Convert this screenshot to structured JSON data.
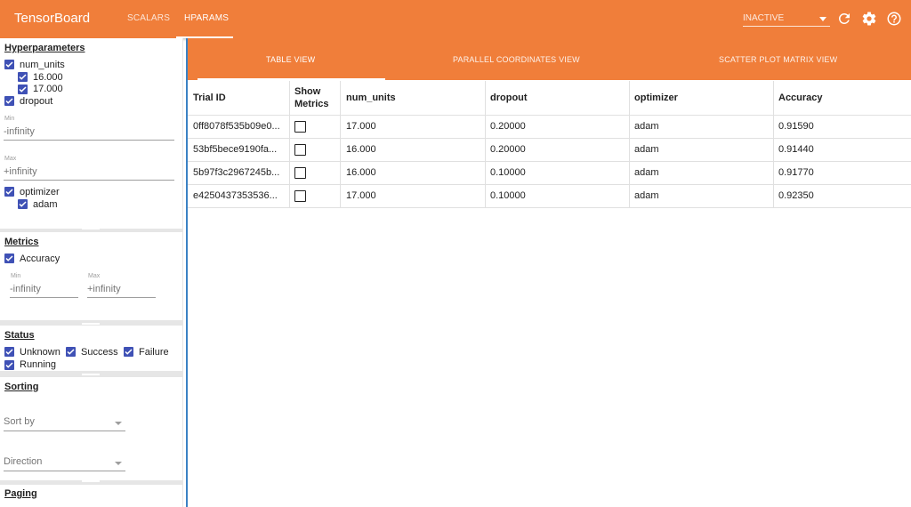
{
  "app": {
    "title": "TensorBoard"
  },
  "nav": {
    "tabs": [
      {
        "label": "SCALARS"
      },
      {
        "label": "HPARAMS"
      }
    ]
  },
  "toolbar": {
    "status_select": "INACTIVE",
    "refresh_icon": "refresh-icon",
    "settings_icon": "gear-icon",
    "help_icon": "help-icon"
  },
  "sidebar": {
    "hyperparameters": {
      "title": "Hyperparameters",
      "num_units": {
        "label": "num_units",
        "values": [
          "16.000",
          "17.000"
        ]
      },
      "dropout": {
        "label": "dropout",
        "min_label": "Min",
        "min_value": "-infinity",
        "max_label": "Max",
        "max_value": "+infinity"
      },
      "optimizer": {
        "label": "optimizer",
        "values": [
          "adam"
        ]
      }
    },
    "metrics": {
      "title": "Metrics",
      "label": "Accuracy",
      "min_label": "Min",
      "min_value": "-infinity",
      "max_label": "Max",
      "max_value": "+infinity"
    },
    "status": {
      "title": "Status",
      "items": [
        "Unknown",
        "Success",
        "Failure",
        "Running"
      ]
    },
    "sorting": {
      "title": "Sorting",
      "sort_by": "Sort by",
      "direction": "Direction"
    },
    "paging": {
      "title": "Paging"
    }
  },
  "views": {
    "tabs": [
      {
        "label": "TABLE VIEW"
      },
      {
        "label": "PARALLEL COORDINATES VIEW"
      },
      {
        "label": "SCATTER PLOT MATRIX VIEW"
      }
    ]
  },
  "table": {
    "headers": {
      "trial_id": "Trial ID",
      "show_metrics_1": "Show",
      "show_metrics_2": "Metrics",
      "num_units": "num_units",
      "dropout": "dropout",
      "optimizer": "optimizer",
      "accuracy": "Accuracy"
    },
    "rows": [
      {
        "trial_id": "0ff8078f535b09e0...",
        "num_units": "17.000",
        "dropout": "0.20000",
        "optimizer": "adam",
        "accuracy": "0.91590"
      },
      {
        "trial_id": "53bf5bece9190fa...",
        "num_units": "16.000",
        "dropout": "0.20000",
        "optimizer": "adam",
        "accuracy": "0.91440"
      },
      {
        "trial_id": "5b97f3c2967245b...",
        "num_units": "16.000",
        "dropout": "0.10000",
        "optimizer": "adam",
        "accuracy": "0.91770"
      },
      {
        "trial_id": "e4250437353536...",
        "num_units": "17.000",
        "dropout": "0.10000",
        "optimizer": "adam",
        "accuracy": "0.92350"
      }
    ]
  },
  "colors": {
    "accent": "#f07e3a",
    "checkbox": "#3f51b5",
    "divider": "#3b82c4"
  }
}
